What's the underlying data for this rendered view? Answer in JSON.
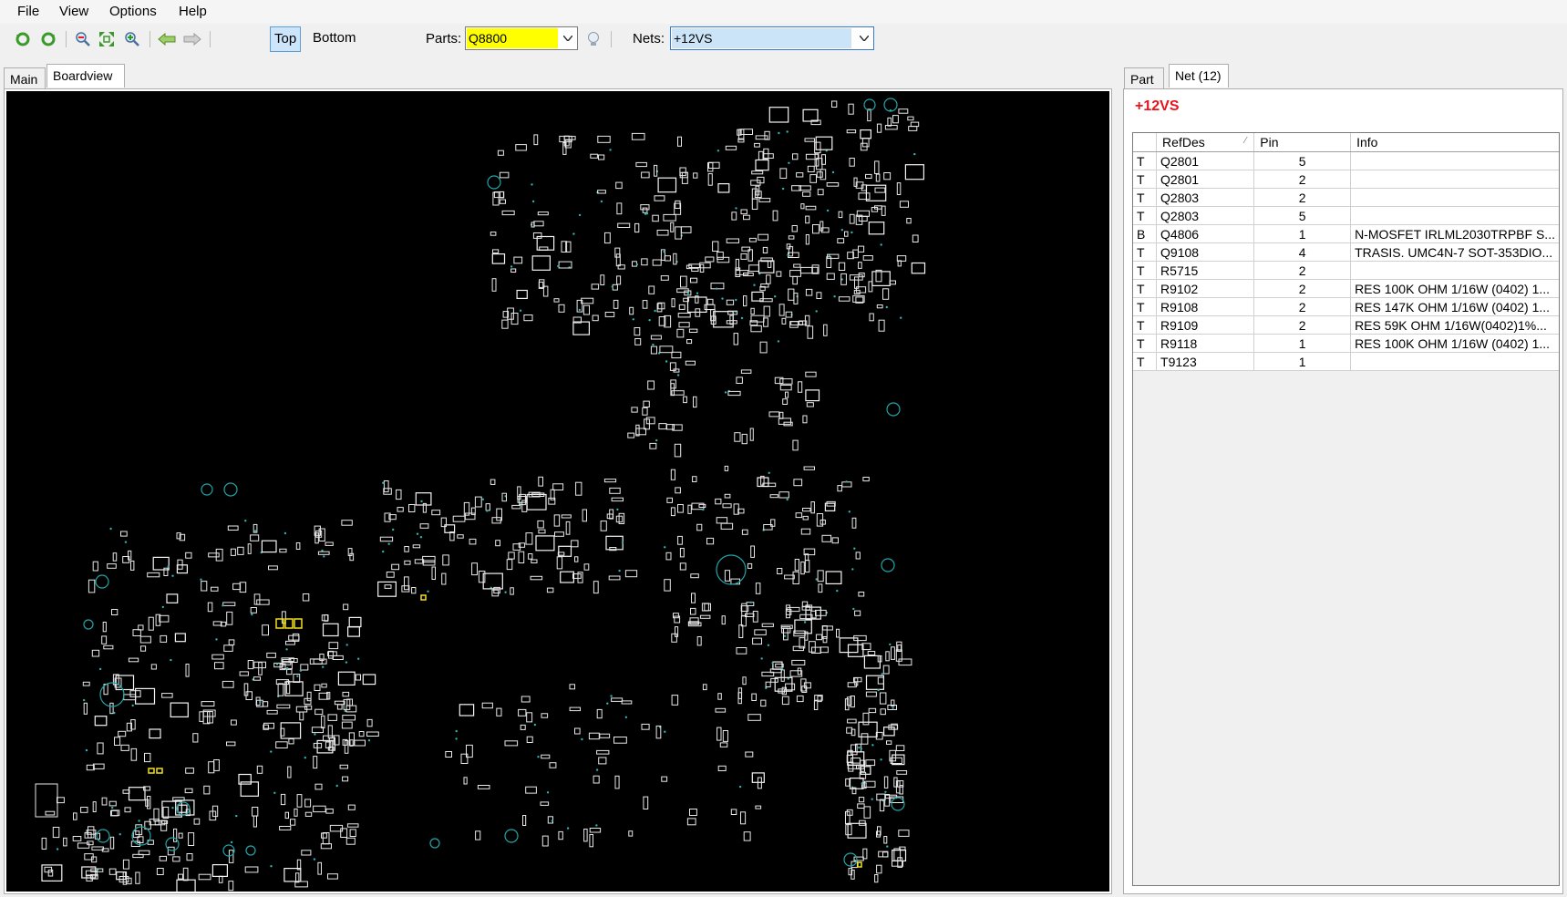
{
  "menu": [
    "File",
    "View",
    "Options",
    "Help"
  ],
  "toolbar": {
    "icons": [
      "refresh-icon",
      "reload-icon",
      "zoom-out-icon",
      "fit-icon",
      "zoom-in-icon",
      "back-arrow-icon",
      "forward-arrow-icon"
    ],
    "side_top": "Top",
    "side_bottom": "Bottom",
    "parts_label": "Parts:",
    "parts_value": "Q8800",
    "nets_label": "Nets:",
    "nets_value": "+12VS",
    "colors": {
      "parts_highlight": "#ffff00",
      "nets_selection": "#cce4f7",
      "active_toggle": "#cde5fb"
    }
  },
  "left_tabs": [
    "Main",
    "Boardview"
  ],
  "right_tabs": [
    "Part",
    "Net (12)"
  ],
  "net_name": "+12VS",
  "net_name_color": "#e8141c",
  "table": {
    "columns": [
      "",
      "RefDes",
      "Pin",
      "Info"
    ],
    "rows": [
      [
        "T",
        "Q2801",
        "5",
        ""
      ],
      [
        "T",
        "Q2801",
        "2",
        ""
      ],
      [
        "T",
        "Q2803",
        "2",
        ""
      ],
      [
        "T",
        "Q2803",
        "5",
        ""
      ],
      [
        "B",
        "Q4806",
        "1",
        "N-MOSFET IRLML2030TRPBF S..."
      ],
      [
        "T",
        "Q9108",
        "4",
        "TRASIS. UMC4N-7 SOT-353DIO..."
      ],
      [
        "T",
        "R5715",
        "2",
        ""
      ],
      [
        "T",
        "R9102",
        "2",
        "RES 100K OHM 1/16W (0402) 1..."
      ],
      [
        "T",
        "R9108",
        "2",
        "RES 147K OHM 1/16W (0402) 1..."
      ],
      [
        "T",
        "R9109",
        "2",
        "RES 59K OHM 1/16W(0402)1%..."
      ],
      [
        "T",
        "R9118",
        "1",
        "RES 100K OHM 1/16W (0402) 1..."
      ],
      [
        "T",
        "T9123",
        "1",
        ""
      ]
    ]
  }
}
